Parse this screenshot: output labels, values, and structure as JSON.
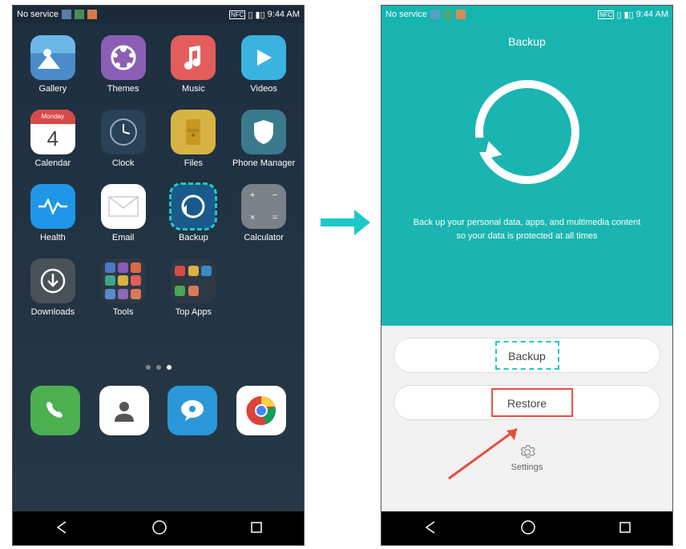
{
  "status": {
    "service": "No service",
    "time": "9:44 AM"
  },
  "home": {
    "apps": [
      {
        "label": "Gallery",
        "icon": "gallery-icon"
      },
      {
        "label": "Themes",
        "icon": "themes-icon"
      },
      {
        "label": "Music",
        "icon": "music-icon"
      },
      {
        "label": "Videos",
        "icon": "videos-icon"
      },
      {
        "label": "Calendar",
        "icon": "calendar-icon"
      },
      {
        "label": "Clock",
        "icon": "clock-icon"
      },
      {
        "label": "Files",
        "icon": "files-icon"
      },
      {
        "label": "Phone Manager",
        "icon": "shield-icon"
      },
      {
        "label": "Health",
        "icon": "health-icon"
      },
      {
        "label": "Email",
        "icon": "email-icon"
      },
      {
        "label": "Backup",
        "icon": "backup-icon"
      },
      {
        "label": "Calculator",
        "icon": "calculator-icon"
      },
      {
        "label": "Downloads",
        "icon": "downloads-icon"
      },
      {
        "label": "Tools",
        "icon": "folder-icon"
      },
      {
        "label": "Top Apps",
        "icon": "folder-icon"
      }
    ],
    "dock": [
      {
        "icon": "phone-icon"
      },
      {
        "icon": "contacts-icon"
      },
      {
        "icon": "messages-icon"
      },
      {
        "icon": "chrome-icon"
      }
    ],
    "calendar_day": "4",
    "calendar_weekday": "Monday"
  },
  "backup": {
    "title": "Backup",
    "description_line1": "Back up your personal data, apps, and multimedia content",
    "description_line2": "so your data is protected at all times",
    "backup_btn": "Backup",
    "restore_btn": "Restore",
    "settings_label": "Settings"
  }
}
